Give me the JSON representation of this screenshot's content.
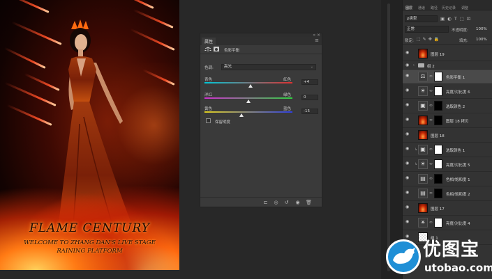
{
  "artwork": {
    "title": "FLAME CENTURY",
    "subtitle_line1": "WELCOME TO ZHANG DAN'S LIVE STAGE",
    "subtitle_line2": "RAINING PLATFORM"
  },
  "properties_panel": {
    "tab_label": "属性",
    "menu_icon": "panel-menu-icon",
    "header_title": "色彩平衡",
    "tone_label": "色调:",
    "tone_value": "高光",
    "sliders": [
      {
        "left_label": "青色",
        "right_label": "红色",
        "value": "+4",
        "position": 0.52,
        "track_from": "#00c8d8",
        "track_to": "#e03030"
      },
      {
        "left_label": "洋红",
        "right_label": "绿色",
        "value": "0",
        "position": 0.5,
        "track_from": "#d030d0",
        "track_to": "#30d040"
      },
      {
        "left_label": "黄色",
        "right_label": "蓝色",
        "value": "-15",
        "position": 0.42,
        "track_from": "#e0d020",
        "track_to": "#3040e0"
      }
    ],
    "preserve_luminosity_label": "保留明度",
    "preserve_luminosity_checked": false,
    "bottom_icons": [
      "clip-to-layer-icon",
      "view-previous-icon",
      "reset-icon",
      "visibility-icon",
      "delete-icon"
    ]
  },
  "layers_panel": {
    "tabs": [
      "图层",
      "通道",
      "路径",
      "历史记录",
      "调整"
    ],
    "active_tab": "图层",
    "kind_label": "ρ类型",
    "blend_mode": "正常",
    "opacity_label": "不透明度:",
    "opacity_value": "100%",
    "lock_label": "锁定:",
    "fill_label": "填充:",
    "fill_value": "100%",
    "layers": [
      {
        "name": "图层 19",
        "type": "image",
        "selected": false
      },
      {
        "name": "组 2",
        "type": "group",
        "selected": false
      },
      {
        "name": "色彩平衡 1",
        "type": "adjustment",
        "icon": "balance-icon",
        "mask": "white",
        "selected": true
      },
      {
        "name": "亮度/对比度 6",
        "type": "adjustment",
        "icon": "sun-icon",
        "mask": "white",
        "selected": false
      },
      {
        "name": "选取颜色 2",
        "type": "adjustment",
        "icon": "selective-color-icon",
        "mask": "black",
        "selected": false
      },
      {
        "name": "图层 18 拷贝",
        "type": "image-mask",
        "mask": "black",
        "selected": false
      },
      {
        "name": "图层 18",
        "type": "image",
        "selected": false
      },
      {
        "name": "选取颜色 1",
        "type": "adjustment",
        "icon": "selective-color-icon",
        "mask": "white",
        "clipped": true,
        "selected": false
      },
      {
        "name": "亮度/对比度 5",
        "type": "adjustment",
        "icon": "sun-icon",
        "mask": "white",
        "clipped": true,
        "selected": false
      },
      {
        "name": "色相/饱和度 1",
        "type": "adjustment",
        "icon": "hue-saturation-icon",
        "mask": "black",
        "selected": false
      },
      {
        "name": "色相/饱和度 2",
        "type": "adjustment",
        "icon": "hue-saturation-icon",
        "mask": "black",
        "selected": false
      },
      {
        "name": "图层 17",
        "type": "image",
        "selected": false
      },
      {
        "name": "亮度/对比度 4",
        "type": "adjustment",
        "icon": "sun-icon",
        "mask": "white",
        "selected": false
      },
      {
        "name": "组 1",
        "type": "image-checker",
        "selected": false
      }
    ]
  },
  "watermark": {
    "brand": "优图宝",
    "url": "utobao.com",
    "color": "#1f8fd6"
  }
}
